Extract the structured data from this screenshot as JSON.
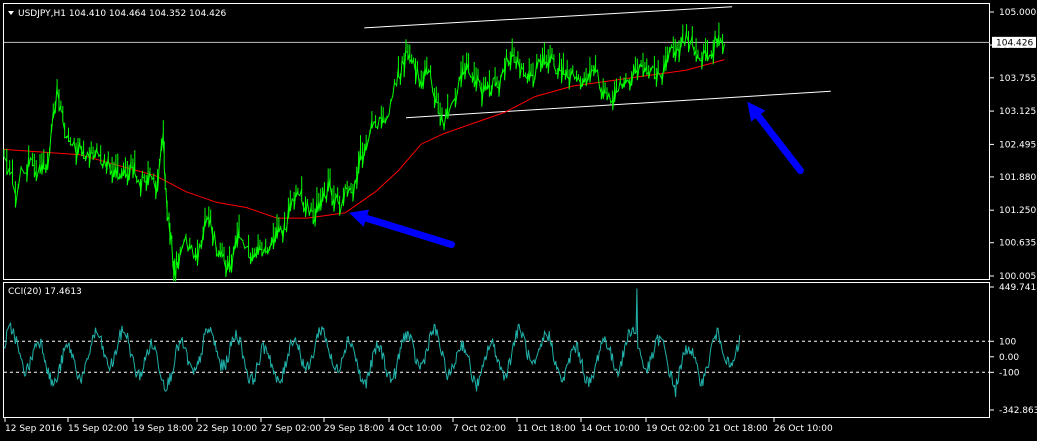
{
  "chart_data": [
    {
      "type": "candlestick",
      "symbol_info": "USDJPY,H1  104.410 104.464 104.352 104.426",
      "current_price_label": "104.426",
      "current_price": 104.426,
      "y_ticks": [
        "105.000",
        "104.375",
        "103.755",
        "103.125",
        "102.495",
        "101.880",
        "101.250",
        "100.635",
        "100.005"
      ],
      "ylim": [
        100.005,
        105.0
      ],
      "x_ticks": [
        "12 Sep 2016",
        "15 Sep 02:00",
        "19 Sep 18:00",
        "22 Sep 10:00",
        "27 Sep 02:00",
        "29 Sep 18:00",
        "4 Oct 10:00",
        "7 Oct 02:00",
        "11 Oct 18:00",
        "14 Oct 10:00",
        "19 Oct 02:00",
        "21 Oct 18:00",
        "26 Oct 10:00"
      ],
      "price_path": [
        [
          0,
          102.3
        ],
        [
          3,
          101.7
        ],
        [
          6,
          102.1
        ],
        [
          8,
          102.2
        ],
        [
          10,
          102.0
        ],
        [
          12,
          102.4
        ],
        [
          14,
          103.6
        ],
        [
          16,
          102.8
        ],
        [
          18,
          102.5
        ],
        [
          20,
          102.4
        ],
        [
          22,
          102.3
        ],
        [
          24,
          102.4
        ],
        [
          26,
          102.1
        ],
        [
          28,
          102.2
        ],
        [
          30,
          102.0
        ],
        [
          32,
          101.9
        ],
        [
          34,
          102.1
        ],
        [
          36,
          101.8
        ],
        [
          38,
          101.9
        ],
        [
          40,
          101.7
        ],
        [
          42,
          102.7
        ],
        [
          43,
          101.2
        ],
        [
          44,
          100.7
        ],
        [
          45,
          100.1
        ],
        [
          46,
          100.4
        ],
        [
          48,
          100.6
        ],
        [
          50,
          100.5
        ],
        [
          52,
          100.7
        ],
        [
          54,
          101.2
        ],
        [
          56,
          100.6
        ],
        [
          58,
          100.3
        ],
        [
          60,
          100.2
        ],
        [
          62,
          100.8
        ],
        [
          64,
          100.4
        ],
        [
          66,
          100.6
        ],
        [
          68,
          100.4
        ],
        [
          70,
          100.7
        ],
        [
          72,
          100.8
        ],
        [
          74,
          100.9
        ],
        [
          76,
          101.5
        ],
        [
          78,
          101.6
        ],
        [
          80,
          101.3
        ],
        [
          82,
          101.2
        ],
        [
          84,
          101.5
        ],
        [
          86,
          101.7
        ],
        [
          88,
          101.4
        ],
        [
          90,
          101.6
        ],
        [
          92,
          101.7
        ],
        [
          94,
          102.3
        ],
        [
          96,
          102.7
        ],
        [
          98,
          102.9
        ],
        [
          100,
          103.0
        ],
        [
          102,
          103.3
        ],
        [
          104,
          103.8
        ],
        [
          106,
          104.2
        ],
        [
          108,
          104.0
        ],
        [
          110,
          103.7
        ],
        [
          112,
          103.9
        ],
        [
          114,
          103.3
        ],
        [
          116,
          103.0
        ],
        [
          118,
          103.3
        ],
        [
          120,
          103.7
        ],
        [
          122,
          104.0
        ],
        [
          124,
          103.9
        ],
        [
          126,
          103.5
        ],
        [
          128,
          103.7
        ],
        [
          130,
          103.6
        ],
        [
          132,
          104.0
        ],
        [
          134,
          104.3
        ],
        [
          136,
          104.1
        ],
        [
          138,
          103.8
        ],
        [
          140,
          103.9
        ],
        [
          142,
          104.2
        ],
        [
          144,
          104.1
        ],
        [
          146,
          104.0
        ],
        [
          148,
          103.9
        ],
        [
          150,
          103.9
        ],
        [
          152,
          103.8
        ],
        [
          154,
          103.8
        ],
        [
          156,
          103.9
        ],
        [
          158,
          103.5
        ],
        [
          160,
          103.4
        ],
        [
          162,
          103.6
        ],
        [
          164,
          103.7
        ],
        [
          166,
          103.9
        ],
        [
          168,
          104.0
        ],
        [
          170,
          103.9
        ],
        [
          172,
          103.8
        ],
        [
          174,
          103.9
        ],
        [
          176,
          104.2
        ],
        [
          178,
          104.3
        ],
        [
          180,
          104.6
        ],
        [
          182,
          104.4
        ],
        [
          184,
          104.2
        ],
        [
          186,
          104.3
        ],
        [
          188,
          104.5
        ],
        [
          190,
          104.4
        ]
      ],
      "moving_average_path": [
        [
          0,
          102.4
        ],
        [
          20,
          102.3
        ],
        [
          40,
          101.9
        ],
        [
          48,
          101.6
        ],
        [
          56,
          101.4
        ],
        [
          64,
          101.3
        ],
        [
          72,
          101.1
        ],
        [
          80,
          101.1
        ],
        [
          90,
          101.2
        ],
        [
          98,
          101.6
        ],
        [
          104,
          102.0
        ],
        [
          110,
          102.5
        ],
        [
          116,
          102.7
        ],
        [
          124,
          102.9
        ],
        [
          132,
          103.1
        ],
        [
          140,
          103.4
        ],
        [
          150,
          103.6
        ],
        [
          160,
          103.7
        ],
        [
          170,
          103.8
        ],
        [
          180,
          103.9
        ],
        [
          190,
          104.1
        ]
      ],
      "channel_upper": [
        [
          95,
          104.7
        ],
        [
          192,
          105.1
        ]
      ],
      "channel_lower": [
        [
          106,
          103.0
        ],
        [
          218,
          103.5
        ]
      ],
      "arrows": [
        [
          118,
          100.6
        ],
        [
          91,
          101.2
        ],
        [
          210,
          102.0
        ],
        [
          196,
          103.3
        ]
      ]
    },
    {
      "type": "line",
      "indicator_label": "CCI(20) 17.4613",
      "y_ticks": [
        "449.7418",
        "100",
        "0.00",
        "-100",
        "-342.8634"
      ],
      "ylim": [
        -342.8634,
        449.7418
      ],
      "levels": [
        100,
        -100
      ]
    }
  ],
  "colors": {
    "background": "#000000",
    "price": "#00ff00",
    "moving_average": "#ff0000",
    "cci": "#20b2aa",
    "arrows": "#0000ff",
    "channel": "#ffffff",
    "grid": "#ffffff"
  }
}
